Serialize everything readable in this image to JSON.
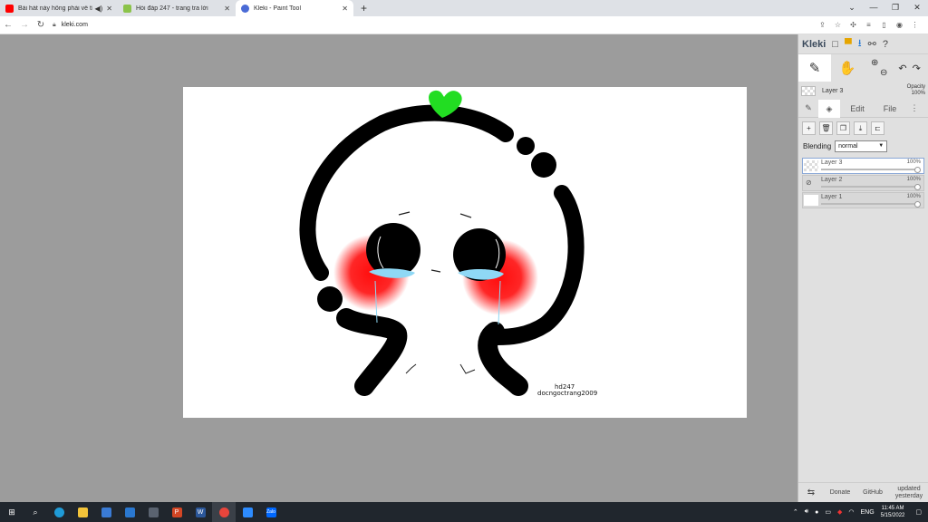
{
  "browser": {
    "tabs": [
      {
        "title": "Bài hát này hông phải về tình",
        "color": "#ff0000",
        "audio": true,
        "active": false
      },
      {
        "title": "Hỏi đáp 247 - trang tra lời",
        "color": "#8bc34a",
        "audio": false,
        "active": false
      },
      {
        "title": "Kleki - Paint Tool",
        "color": "#4a6bd6",
        "audio": false,
        "active": true
      }
    ],
    "new_tab": "+",
    "url": "kleki.com"
  },
  "app": {
    "logo": "Kleki",
    "current_layer": {
      "name": "Layer 3",
      "opacity_label": "Opacity",
      "opacity": "100%"
    },
    "panel_tabs": {
      "edit": "Edit",
      "file": "File"
    },
    "blending_label": "Blending",
    "blending_value": "normal",
    "layers": [
      {
        "name": "Layer 3",
        "opacity": "100%",
        "active": true,
        "hidden_icon": false
      },
      {
        "name": "Layer 2",
        "opacity": "100%",
        "active": false,
        "hidden_icon": true
      },
      {
        "name": "Layer 1",
        "opacity": "100%",
        "active": false,
        "hidden_icon": false
      }
    ],
    "footer": {
      "donate": "Donate",
      "github": "GitHub",
      "updated": "updated yesterday"
    }
  },
  "artwork": {
    "signature_line1": "hd247",
    "signature_line2": "docngoctrang2009",
    "colors": {
      "stroke": "#000000",
      "heart": "#22dd22",
      "blush": "#ff0000",
      "tears": "#8fd8f5"
    }
  },
  "taskbar": {
    "language": "ENG",
    "time": "11:45 AM",
    "date": "5/15/2022"
  }
}
